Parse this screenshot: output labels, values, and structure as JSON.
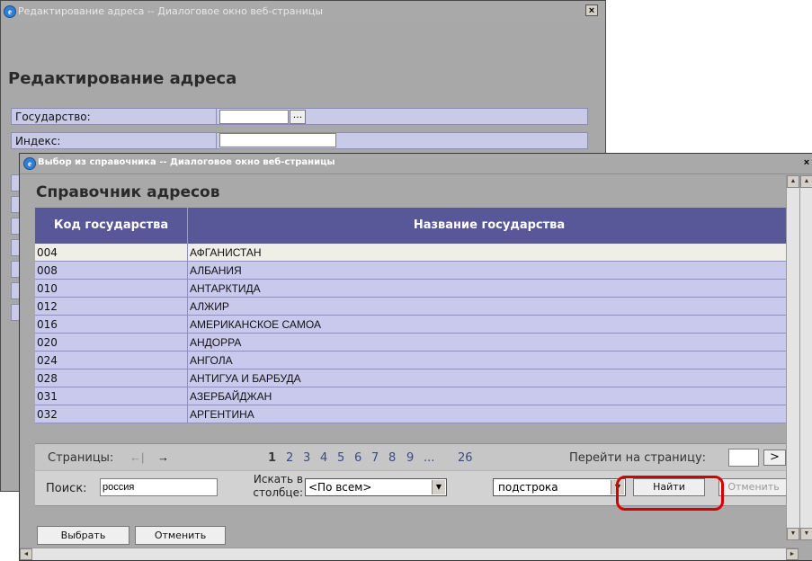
{
  "outer_dialog": {
    "title": "Редактирование адреса -- Диалоговое окно веб-страницы",
    "close": "×",
    "heading": "Редактирование адреса",
    "fields": [
      {
        "label": "Государство:"
      },
      {
        "label": "Индекс:"
      }
    ],
    "browse_button": "..."
  },
  "inner_dialog": {
    "title": "Выбор из справочника -- Диалоговое окно веб-страницы",
    "close": "×",
    "heading": "Справочник адресов",
    "columns": [
      "Код государства",
      "Название государства"
    ],
    "rows": [
      {
        "code": "004",
        "name": "АФГАНИСТАН"
      },
      {
        "code": "008",
        "name": "АЛБАНИЯ"
      },
      {
        "code": "010",
        "name": "АНТАРКТИДА"
      },
      {
        "code": "012",
        "name": "АЛЖИР"
      },
      {
        "code": "016",
        "name": "АМЕРИКАНСКОЕ САМОА"
      },
      {
        "code": "020",
        "name": "АНДОРРА"
      },
      {
        "code": "024",
        "name": "АНГОЛА"
      },
      {
        "code": "028",
        "name": "АНТИГУА И БАРБУДА"
      },
      {
        "code": "031",
        "name": "АЗЕРБАЙДЖАН"
      },
      {
        "code": "032",
        "name": "АРГЕНТИНА"
      }
    ],
    "pager": {
      "label": "Страницы:",
      "first_arrow": "←|",
      "next_arrow": "→",
      "pages": [
        "1",
        "2",
        "3",
        "4",
        "5",
        "6",
        "7",
        "8",
        "9",
        "...",
        "26"
      ],
      "current_page": "1",
      "goto_label": "Перейти на страницу:",
      "goto_button": ">"
    },
    "search": {
      "label": "Поиск:",
      "value": "россия",
      "column_label_1": "Искать в",
      "column_label_2": "столбце:",
      "column_value": "<По всем>",
      "mode_value": "подстрока",
      "find_button": "Найти",
      "cancel_button": "Отменить"
    },
    "footer": {
      "select_button": "Выбрать",
      "cancel_button": "Отменить"
    },
    "highlight_color": "#d40000"
  }
}
